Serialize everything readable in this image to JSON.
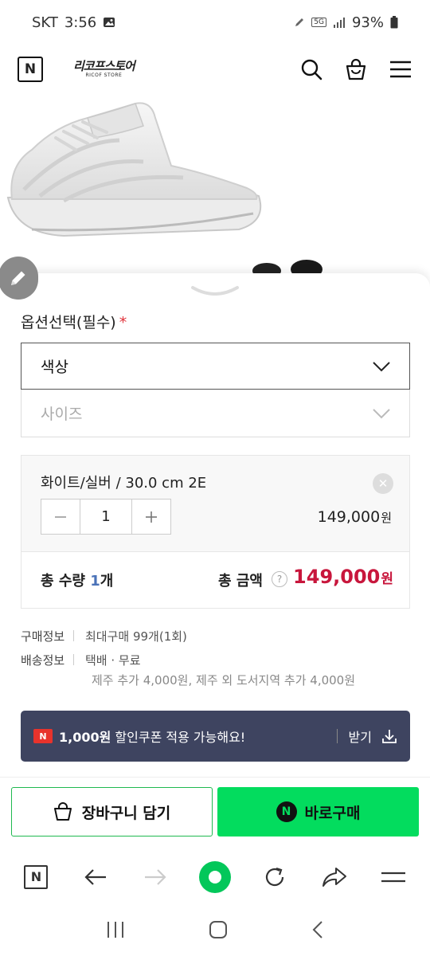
{
  "status_bar": {
    "carrier": "SKT",
    "time": "3:56",
    "network": "5G",
    "battery": "93%"
  },
  "header": {
    "store_logo": "리코프스토어",
    "store_logo_sub": "RICOF STORE",
    "logo_letter": "N"
  },
  "options": {
    "title": "옵션선택(필수)",
    "required_mark": "*",
    "color_label": "색상",
    "size_label": "사이즈"
  },
  "selected_item": {
    "name": "화이트/실버 / 30.0 cm 2E",
    "quantity": "1",
    "price": "149,000",
    "currency": "원",
    "remove_glyph": "✕"
  },
  "totals": {
    "qty_label": "총 수량",
    "qty_value": "1",
    "qty_unit": "개",
    "amount_label": "총 금액",
    "help_glyph": "?",
    "amount": "149,000",
    "currency": "원"
  },
  "purchase_info": {
    "label": "구매정보",
    "value": "최대구매 99개(1회)"
  },
  "delivery_info": {
    "label": "배송정보",
    "value": "택배 · 무료",
    "extra": "제주 추가 4,000원, 제주 외 도서지역 추가 4,000원"
  },
  "coupon": {
    "badge": "N",
    "amount": "1,000원",
    "text": " 할인쿠폰 적용 가능해요!",
    "action": "받기"
  },
  "buttons": {
    "cart": "장바구니 담기",
    "buy": "바로구매",
    "buy_badge": "N"
  },
  "browser_toolbar": {
    "logo_letter": "N"
  },
  "colors": {
    "naver_green": "#03dc5e",
    "price_red": "#c8163c",
    "coupon_bg": "#3e4460"
  }
}
